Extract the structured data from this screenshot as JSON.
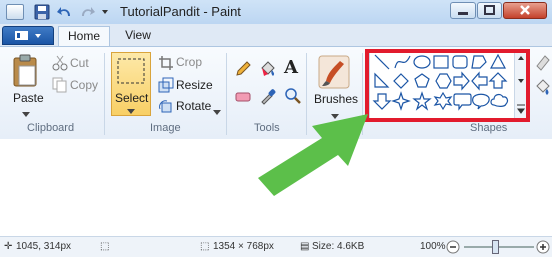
{
  "window": {
    "title": "TutorialPandit - Paint"
  },
  "tabs": {
    "file": "",
    "home": "Home",
    "view": "View"
  },
  "clipboard": {
    "paste": "Paste",
    "cut": "Cut",
    "copy": "Copy",
    "group": "Clipboard"
  },
  "image": {
    "select": "Select",
    "crop": "Crop",
    "resize": "Resize",
    "rotate": "Rotate",
    "group": "Image"
  },
  "tools": {
    "group": "Tools",
    "text_tool": "A"
  },
  "brushes": {
    "label": "Brushes"
  },
  "shapes": {
    "group": "Shapes"
  },
  "status": {
    "cursor": "1045, 314px",
    "dimensions": "1354 × 768px",
    "size": "Size: 4.6KB",
    "zoom": "100%"
  },
  "colors": {
    "accent": "#1b55a5",
    "highlight": "#e21b2d",
    "arrow": "#5cbf4a"
  },
  "icons": [
    "save-icon",
    "undo-icon",
    "redo-icon",
    "paste-icon",
    "cut-icon",
    "copy-icon",
    "crop-icon",
    "resize-icon",
    "rotate-icon",
    "pencil-icon",
    "fill-icon",
    "text-icon",
    "eraser-icon",
    "color-picker-icon",
    "magnifier-icon",
    "brush-icon",
    "fill-shape-icon"
  ]
}
